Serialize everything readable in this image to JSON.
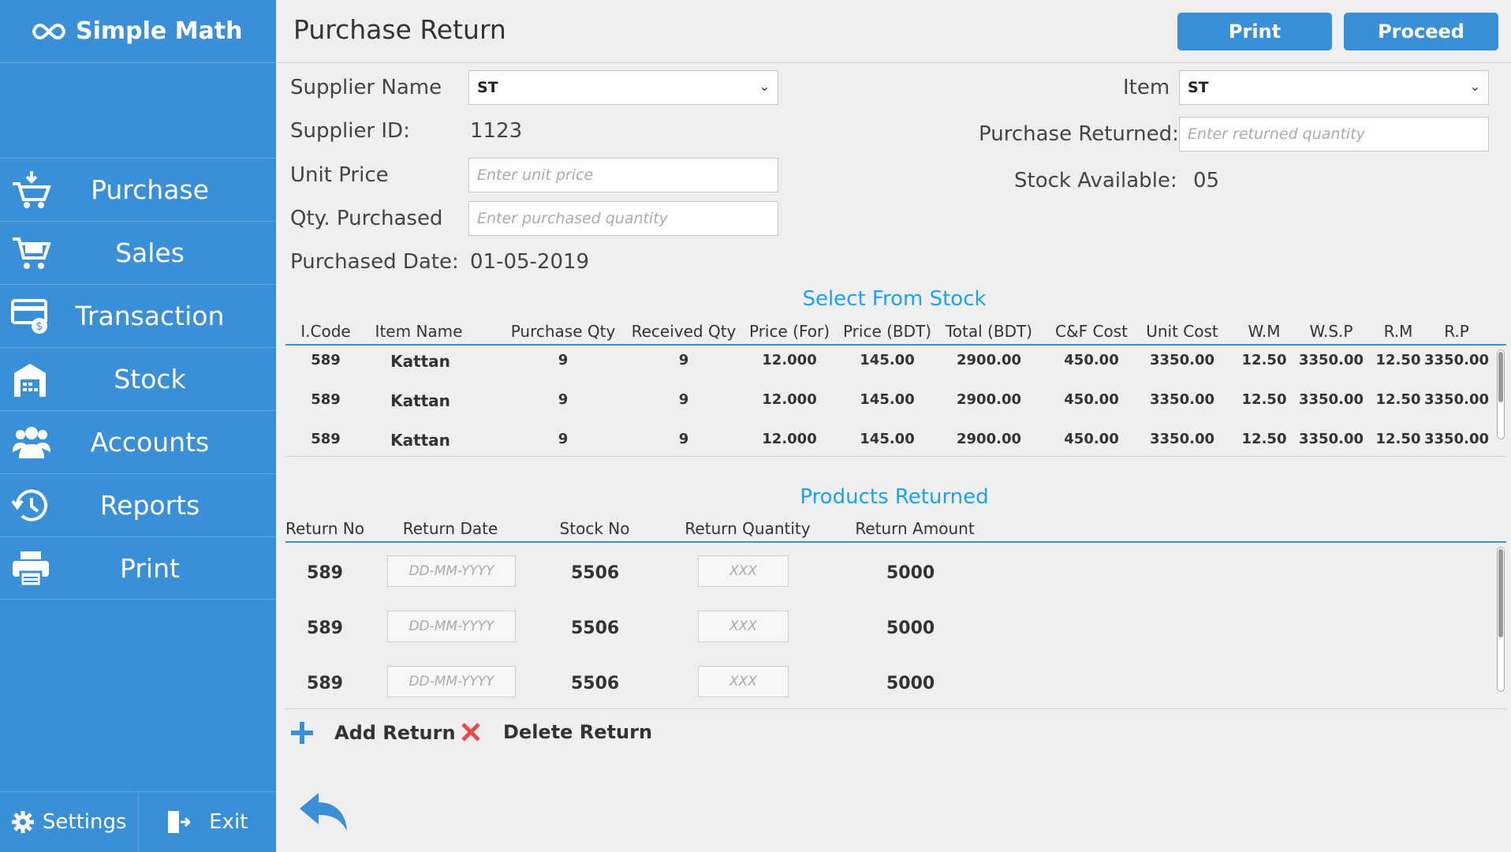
{
  "app": {
    "name": "Simple Math"
  },
  "sidebar": {
    "items": [
      {
        "label": "Purchase"
      },
      {
        "label": "Sales"
      },
      {
        "label": "Transaction"
      },
      {
        "label": "Stock"
      },
      {
        "label": "Accounts"
      },
      {
        "label": "Reports"
      },
      {
        "label": "Print"
      }
    ],
    "settings_label": "Settings",
    "exit_label": "Exit"
  },
  "header": {
    "title": "Purchase Return",
    "print_label": "Print",
    "proceed_label": "Proceed"
  },
  "form": {
    "supplier_name_label": "Supplier Name",
    "supplier_name_value": "ST",
    "supplier_id_label": "Supplier ID:",
    "supplier_id_value": "1123",
    "unit_price_label": "Unit Price",
    "unit_price_placeholder": "Enter unit price",
    "qty_purchased_label": "Qty. Purchased",
    "qty_purchased_placeholder": "Enter purchased quantity",
    "purchased_date_label": "Purchased Date:",
    "purchased_date_value": "01-05-2019",
    "item_label": "Item",
    "item_value": "ST",
    "purchase_returned_label": "Purchase Returned:",
    "purchase_returned_placeholder": "Enter returned quantity",
    "stock_available_label": "Stock Available:",
    "stock_available_value": "05"
  },
  "stock_table": {
    "title": "Select From Stock",
    "headers": [
      "I.Code",
      "Item Name",
      "Purchase Qty",
      "Received Qty",
      "Price (For)",
      "Price (BDT)",
      "Total (BDT)",
      "C&F Cost",
      "Unit Cost",
      "W.M",
      "W.S.P",
      "R.M",
      "R.P"
    ],
    "rows": [
      [
        "589",
        "Kattan",
        "9",
        "9",
        "12.000",
        "145.00",
        "2900.00",
        "450.00",
        "3350.00",
        "12.50",
        "3350.00",
        "12.50",
        "3350.00"
      ],
      [
        "589",
        "Kattan",
        "9",
        "9",
        "12.000",
        "145.00",
        "2900.00",
        "450.00",
        "3350.00",
        "12.50",
        "3350.00",
        "12.50",
        "3350.00"
      ],
      [
        "589",
        "Kattan",
        "9",
        "9",
        "12.000",
        "145.00",
        "2900.00",
        "450.00",
        "3350.00",
        "12.50",
        "3350.00",
        "12.50",
        "3350.00"
      ]
    ]
  },
  "returns_table": {
    "title": "Products Returned",
    "headers": [
      "Return No",
      "Return Date",
      "Stock No",
      "Return Quantity",
      "Return Amount"
    ],
    "rows": [
      {
        "return_no": "589",
        "date_placeholder": "DD-MM-YYYY",
        "stock_no": "5506",
        "qty_placeholder": "XXX",
        "amount": "5000"
      },
      {
        "return_no": "589",
        "date_placeholder": "DD-MM-YYYY",
        "stock_no": "5506",
        "qty_placeholder": "XXX",
        "amount": "5000"
      },
      {
        "return_no": "589",
        "date_placeholder": "DD-MM-YYYY",
        "stock_no": "5506",
        "qty_placeholder": "XXX",
        "amount": "5000"
      }
    ]
  },
  "actions": {
    "add_label": "Add Return",
    "delete_label": "Delete Return"
  },
  "colors": {
    "sidebar": "#3a8fd6",
    "accent": "#1da1f2",
    "delete": "#e84a4a"
  }
}
